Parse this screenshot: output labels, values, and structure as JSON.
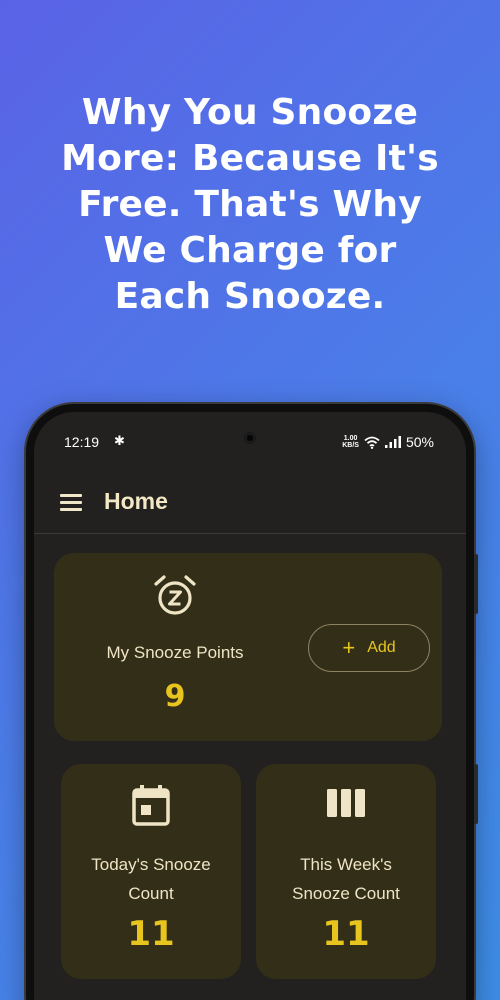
{
  "headline": {
    "line1": "Why You Snooze",
    "line2": "More: Because It's",
    "line3": "Free. That's Why",
    "line4": "We Charge for",
    "line5": "Each Snooze."
  },
  "status_bar": {
    "time": "12:19",
    "net_speed_value": "1.00",
    "net_speed_unit": "KB/S",
    "battery": "50%",
    "icons": [
      "slack-icon",
      "wifi-icon",
      "signal-icon"
    ]
  },
  "app_bar": {
    "title": "Home",
    "menu_icon": "hamburger-menu-icon"
  },
  "snooze_points": {
    "icon": "alarm-clock-z-icon",
    "label": "My Snooze Points",
    "value": "9",
    "add_label": "Add",
    "add_icon": "plus-icon"
  },
  "stats": [
    {
      "icon": "calendar-icon",
      "label_line1": "Today's Snooze",
      "label_line2": "Count",
      "value": "11"
    },
    {
      "icon": "week-bars-icon",
      "label_line1": "This Week's",
      "label_line2": "Snooze Count",
      "value": "11"
    }
  ],
  "colors": {
    "background_start": "#5a63e6",
    "background_end": "#3d8de6",
    "screen_bg": "#222120",
    "card_bg": "#332e17",
    "accent": "#e8c51e",
    "text": "#efe4c5"
  }
}
